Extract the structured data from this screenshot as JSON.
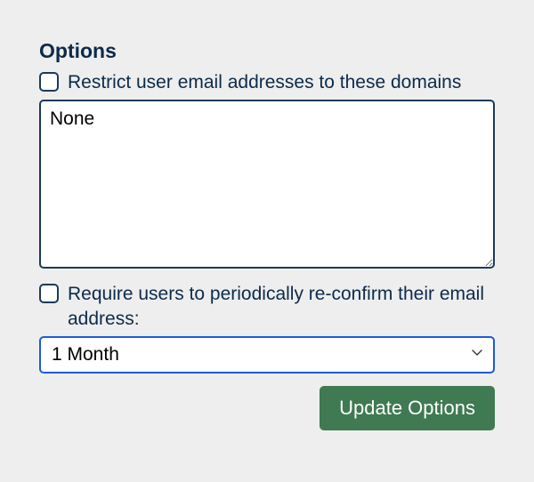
{
  "options": {
    "title": "Options",
    "restrict": {
      "label": "Restrict user email addresses to these domains",
      "checked": false
    },
    "domains_value": "None",
    "reconfirm": {
      "label": "Require users to periodically re-confirm their email address:",
      "checked": false
    },
    "period_value": "1 Month",
    "update_label": "Update Options"
  }
}
